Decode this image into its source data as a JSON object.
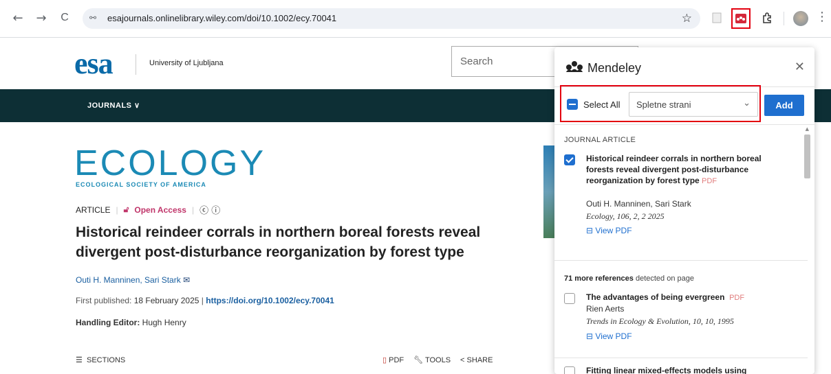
{
  "browser": {
    "url": "esajournals.onlinelibrary.wiley.com/doi/10.1002/ecy.70041",
    "back": "←",
    "forward": "→",
    "reload": "C",
    "star": "☆",
    "menu": "⋮"
  },
  "site": {
    "logo": "esa",
    "university": "University of Ljubljana",
    "search_placeholder": "Search",
    "nav_journals": "JOURNALS ∨"
  },
  "article": {
    "journal_logo": "ECOLOGY",
    "journal_sub": "ECOLOGICAL SOCIETY OF AMERICA",
    "type": "ARTICLE",
    "open_access": "Open Access",
    "title": "Historical reindeer corrals in northern boreal forests reveal divergent post-disturbance reorganization by forest type",
    "authors": "Outi H. Manninen, Sari Stark",
    "first_published_label": "First published:",
    "first_published": "18 February 2025",
    "doi": "https://doi.org/10.1002/ecy.70041",
    "editor_label": "Handling Editor:",
    "editor": "Hugh Henry",
    "sections": "SECTIONS",
    "pdf": "PDF",
    "tools": "TOOLS",
    "share": "SHARE"
  },
  "mendeley": {
    "title": "Mendeley",
    "select_all": "Select All",
    "collection": "Spletne strani",
    "add": "Add",
    "section_label": "JOURNAL ARTICLE",
    "items": [
      {
        "title": "Historical reindeer corrals in northern boreal forests reveal divergent post-disturbance reorganization by forest type",
        "pdf": "PDF",
        "authors": "Outi H. Manninen, Sari Stark",
        "source": "Ecology, 106, 2, 2 2025",
        "view": "View PDF"
      },
      {
        "title": "The advantages of being evergreen",
        "pdf": "PDF",
        "authors": "Rien Aerts",
        "source": "Trends in Ecology & Evolution, 10, 10, 1995",
        "view": "View PDF"
      },
      {
        "title": "Fitting linear mixed-effects models using",
        "pdf": "",
        "authors": "",
        "source": "",
        "view": ""
      }
    ],
    "more_count": "71 more references",
    "more_text": "detected on page"
  }
}
